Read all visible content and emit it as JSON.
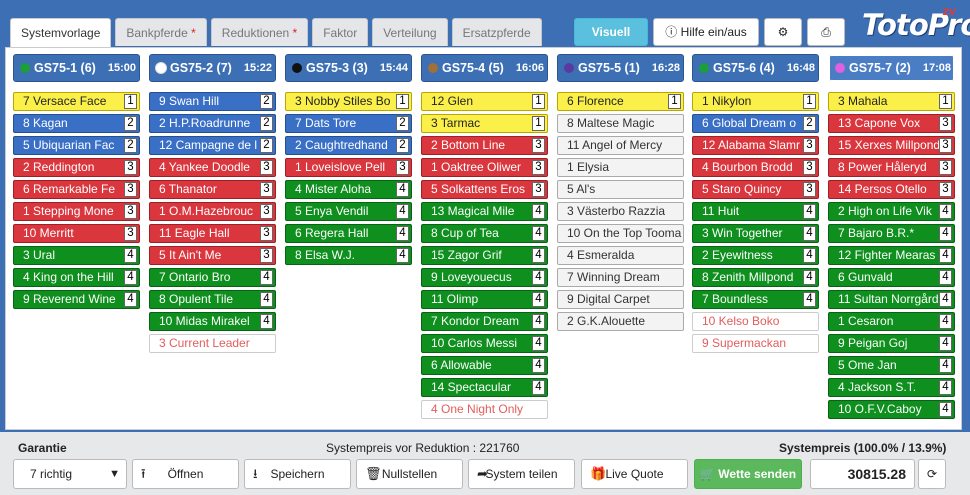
{
  "tabs": [
    {
      "label": "Systemvorlage",
      "active": true,
      "star": false
    },
    {
      "label": "Bankpferde",
      "active": false,
      "star": true
    },
    {
      "label": "Reduktionen",
      "active": false,
      "star": true
    },
    {
      "label": "Faktor",
      "active": false,
      "star": false
    },
    {
      "label": "Verteilung",
      "active": false,
      "star": false
    },
    {
      "label": "Ersatzpferde",
      "active": false,
      "star": false
    }
  ],
  "toolbar": {
    "visuell_label": "Visuell",
    "hilfe_label": "Hilfe ein/aus",
    "logo_text": "TotoPro",
    "logo_sup": "ZV"
  },
  "races": [
    {
      "name": "GS75-1 (6)",
      "time": "15:00",
      "dot": "#1c9e3a",
      "selected": false,
      "horses": [
        {
          "label": "7 Versace Face",
          "rank": "1",
          "color": "yellow"
        },
        {
          "label": "8 Kagan",
          "rank": "2",
          "color": "blue"
        },
        {
          "label": "5 Ubiquarian Fac",
          "rank": "2",
          "color": "blue"
        },
        {
          "label": "2 Reddington",
          "rank": "3",
          "color": "red"
        },
        {
          "label": "6 Remarkable Fe",
          "rank": "3",
          "color": "red"
        },
        {
          "label": "1 Stepping Mone",
          "rank": "3",
          "color": "red"
        },
        {
          "label": "10 Merritt",
          "rank": "3",
          "color": "red"
        },
        {
          "label": "3 Ural",
          "rank": "4",
          "color": "green"
        },
        {
          "label": "4 King on the Hill",
          "rank": "4",
          "color": "green"
        },
        {
          "label": "9 Reverend Wine",
          "rank": "4",
          "color": "green"
        }
      ]
    },
    {
      "name": "GS75-2 (7)",
      "time": "15:22",
      "dot": "#ffffff",
      "selected": false,
      "horses": [
        {
          "label": "9 Swan Hill",
          "rank": "2",
          "color": "blue"
        },
        {
          "label": "2 H.P.Roadrunne",
          "rank": "2",
          "color": "blue"
        },
        {
          "label": "12 Campagne de l",
          "rank": "2",
          "color": "blue"
        },
        {
          "label": "4 Yankee Doodle",
          "rank": "3",
          "color": "red"
        },
        {
          "label": "6 Thanator",
          "rank": "3",
          "color": "red"
        },
        {
          "label": "1 O.M.Hazebrouc",
          "rank": "3",
          "color": "red"
        },
        {
          "label": "11 Eagle Hall",
          "rank": "3",
          "color": "red"
        },
        {
          "label": "5 It Ain't Me",
          "rank": "3",
          "color": "red"
        },
        {
          "label": "7 Ontario Bro",
          "rank": "4",
          "color": "green"
        },
        {
          "label": "8 Opulent Tile",
          "rank": "4",
          "color": "green"
        },
        {
          "label": "10 Midas Mirakel",
          "rank": "4",
          "color": "green"
        },
        {
          "label": "3 Current Leader",
          "rank": "",
          "color": "scratched"
        }
      ]
    },
    {
      "name": "GS75-3 (3)",
      "time": "15:44",
      "dot": "#111111",
      "selected": false,
      "horses": [
        {
          "label": "3 Nobby Stiles Bo",
          "rank": "1",
          "color": "yellow"
        },
        {
          "label": "7 Dats Tore",
          "rank": "2",
          "color": "blue"
        },
        {
          "label": "2 Caughtredhand",
          "rank": "2",
          "color": "blue"
        },
        {
          "label": "1 Loveislove Pell",
          "rank": "3",
          "color": "red"
        },
        {
          "label": "4 Mister Aloha",
          "rank": "4",
          "color": "green"
        },
        {
          "label": "5 Enya Vendil",
          "rank": "4",
          "color": "green"
        },
        {
          "label": "6 Regera Hall",
          "rank": "4",
          "color": "green"
        },
        {
          "label": "8 Elsa W.J.",
          "rank": "4",
          "color": "green"
        }
      ]
    },
    {
      "name": "GS75-4 (5)",
      "time": "16:06",
      "dot": "#a07038",
      "selected": false,
      "horses": [
        {
          "label": "12 Glen",
          "rank": "1",
          "color": "yellow"
        },
        {
          "label": "3 Tarmac",
          "rank": "1",
          "color": "yellow"
        },
        {
          "label": "2 Bottom Line",
          "rank": "3",
          "color": "red"
        },
        {
          "label": "1 Oaktree Oliwer",
          "rank": "3",
          "color": "red"
        },
        {
          "label": "5 Solkattens Eros",
          "rank": "3",
          "color": "red"
        },
        {
          "label": "13 Magical Mile",
          "rank": "4",
          "color": "green"
        },
        {
          "label": "8 Cup of Tea",
          "rank": "4",
          "color": "green"
        },
        {
          "label": "15 Zagor Grif",
          "rank": "4",
          "color": "green"
        },
        {
          "label": "9 Loveyouecus",
          "rank": "4",
          "color": "green"
        },
        {
          "label": "11 Olimp",
          "rank": "4",
          "color": "green"
        },
        {
          "label": "7 Kondor Dream",
          "rank": "4",
          "color": "green"
        },
        {
          "label": "10 Carlos Messi",
          "rank": "4",
          "color": "green"
        },
        {
          "label": "6 Allowable",
          "rank": "4",
          "color": "green"
        },
        {
          "label": "14 Spectacular",
          "rank": "4",
          "color": "green"
        },
        {
          "label": "4 One Night Only",
          "rank": "",
          "color": "scratched"
        }
      ]
    },
    {
      "name": "GS75-5 (1)",
      "time": "16:28",
      "dot": "#5a3aa0",
      "selected": false,
      "horses": [
        {
          "label": "6 Florence",
          "rank": "1",
          "color": "yellow"
        },
        {
          "label": "8 Maltese Magic",
          "rank": "",
          "color": "white"
        },
        {
          "label": "11 Angel of Mercy",
          "rank": "",
          "color": "white"
        },
        {
          "label": "1 Elysia",
          "rank": "",
          "color": "white"
        },
        {
          "label": "5 Al's",
          "rank": "",
          "color": "white"
        },
        {
          "label": "3 Västerbo Razzia",
          "rank": "",
          "color": "white"
        },
        {
          "label": "10 On the Top Tooma",
          "rank": "",
          "color": "white"
        },
        {
          "label": "4 Esmeralda",
          "rank": "",
          "color": "white"
        },
        {
          "label": "7 Winning Dream",
          "rank": "",
          "color": "white"
        },
        {
          "label": "9 Digital Carpet",
          "rank": "",
          "color": "white"
        },
        {
          "label": "2 G.K.Alouette",
          "rank": "",
          "color": "white"
        }
      ]
    },
    {
      "name": "GS75-6 (4)",
      "time": "16:48",
      "dot": "#1c9e3a",
      "selected": false,
      "horses": [
        {
          "label": "1 Nikylon",
          "rank": "1",
          "color": "yellow"
        },
        {
          "label": "6 Global Dream o",
          "rank": "2",
          "color": "blue"
        },
        {
          "label": "12 Alabama Slamr",
          "rank": "3",
          "color": "red"
        },
        {
          "label": "4 Bourbon Brodd",
          "rank": "3",
          "color": "red"
        },
        {
          "label": "5 Staro Quincy",
          "rank": "3",
          "color": "red"
        },
        {
          "label": "11 Huit",
          "rank": "4",
          "color": "green"
        },
        {
          "label": "3 Win Together",
          "rank": "4",
          "color": "green"
        },
        {
          "label": "2 Eyewitness",
          "rank": "4",
          "color": "green"
        },
        {
          "label": "8 Zenith Millpond",
          "rank": "4",
          "color": "green"
        },
        {
          "label": "7 Boundless",
          "rank": "4",
          "color": "green"
        },
        {
          "label": "10 Kelso Boko",
          "rank": "",
          "color": "scratched"
        },
        {
          "label": "9 Supermackan",
          "rank": "",
          "color": "scratched"
        }
      ]
    },
    {
      "name": "GS75-7 (2)",
      "time": "17:08",
      "dot": "#e060e0",
      "selected": true,
      "horses": [
        {
          "label": "3 Mahala",
          "rank": "1",
          "color": "yellow"
        },
        {
          "label": "13 Capone Vox",
          "rank": "3",
          "color": "red"
        },
        {
          "label": "15 Xerxes Millpond",
          "rank": "3",
          "color": "red"
        },
        {
          "label": "8 Power Håleryd",
          "rank": "3",
          "color": "red"
        },
        {
          "label": "14 Persos Otello",
          "rank": "3",
          "color": "red"
        },
        {
          "label": "2 High on Life Vik",
          "rank": "4",
          "color": "green"
        },
        {
          "label": "7 Bajaro B.R.*",
          "rank": "4",
          "color": "green"
        },
        {
          "label": "12 Fighter Mearas",
          "rank": "4",
          "color": "green"
        },
        {
          "label": "6 Gunvald",
          "rank": "4",
          "color": "green"
        },
        {
          "label": "11 Sultan Norrgård",
          "rank": "4",
          "color": "green"
        },
        {
          "label": "1 Cesaron",
          "rank": "4",
          "color": "green"
        },
        {
          "label": "9 Peigan Goj",
          "rank": "4",
          "color": "green"
        },
        {
          "label": "5 Ome Jan",
          "rank": "4",
          "color": "green"
        },
        {
          "label": "4 Jackson S.T.",
          "rank": "4",
          "color": "green"
        },
        {
          "label": "10 O.F.V.Caboy",
          "rank": "4",
          "color": "green"
        }
      ]
    }
  ],
  "footer": {
    "garantie_label": "Garantie",
    "garantie_value": "7 richtig",
    "price_before_label": "Systempreis vor Reduktion : 221760",
    "systempreis_label": "Systempreis (100.0% / 13.9%)",
    "systempreis_value": "30815.28",
    "open_label": "Öffnen",
    "save_label": "Speichern",
    "reset_label": "Nullstellen",
    "share_label": "System teilen",
    "quote_label": "Live Quote",
    "send_label": "Wette senden"
  }
}
